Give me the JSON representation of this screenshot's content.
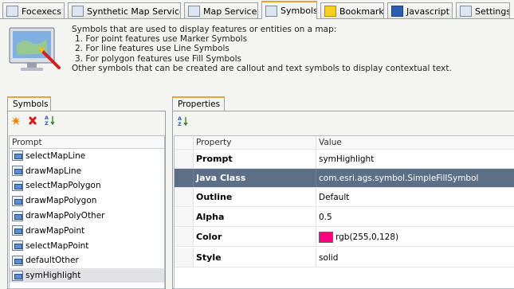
{
  "tabs": [
    {
      "label": "Focexecs",
      "icon": "focexec-icon"
    },
    {
      "label": "Synthetic Map Services",
      "icon": "synthetic-map-icon"
    },
    {
      "label": "Map Services",
      "icon": "map-services-icon"
    },
    {
      "label": "Symbols",
      "icon": "symbols-icon",
      "active": true
    },
    {
      "label": "Bookmarks",
      "icon": "bookmarks-icon"
    },
    {
      "label": "Javascript",
      "icon": "javascript-icon"
    },
    {
      "label": "Settings",
      "icon": "settings-icon"
    }
  ],
  "description": {
    "line1": "Symbols that are used to display features or entities on a map:",
    "item1": "1. For point features use Marker Symbols",
    "item2": "2. For line features use Line Symbols",
    "item3": "3. For polygon features use Fill Symbols",
    "line5": "Other symbols that can be created are callout and text symbols to display contextual text."
  },
  "symbols_panel": {
    "tab_label": "Symbols",
    "column_header": "Prompt",
    "items": [
      "selectMapLine",
      "drawMapLine",
      "selectMapPolygon",
      "drawMapPolygon",
      "drawMapPolyOther",
      "drawMapPoint",
      "selectMapPoint",
      "defaultOther",
      "symHighlight"
    ],
    "selected": "symHighlight"
  },
  "properties_panel": {
    "tab_label": "Properties",
    "header_property": "Property",
    "header_value": "Value",
    "rows": [
      {
        "property": "Prompt",
        "value": "symHighlight"
      },
      {
        "property": "Java Class",
        "value": "com.esri.ags.symbol.SimpleFillSymbol"
      },
      {
        "property": "Outline",
        "value": "Default"
      },
      {
        "property": "Alpha",
        "value": "0.5"
      },
      {
        "property": "Color",
        "value": "rgb(255,0,128)"
      },
      {
        "property": "Style",
        "value": "solid"
      }
    ],
    "selected_row": "Java Class",
    "color_swatch": "#ff0080"
  },
  "colors": {
    "active_tab_accent": "#f0a030",
    "selected_row_bg": "#5c6f86"
  }
}
